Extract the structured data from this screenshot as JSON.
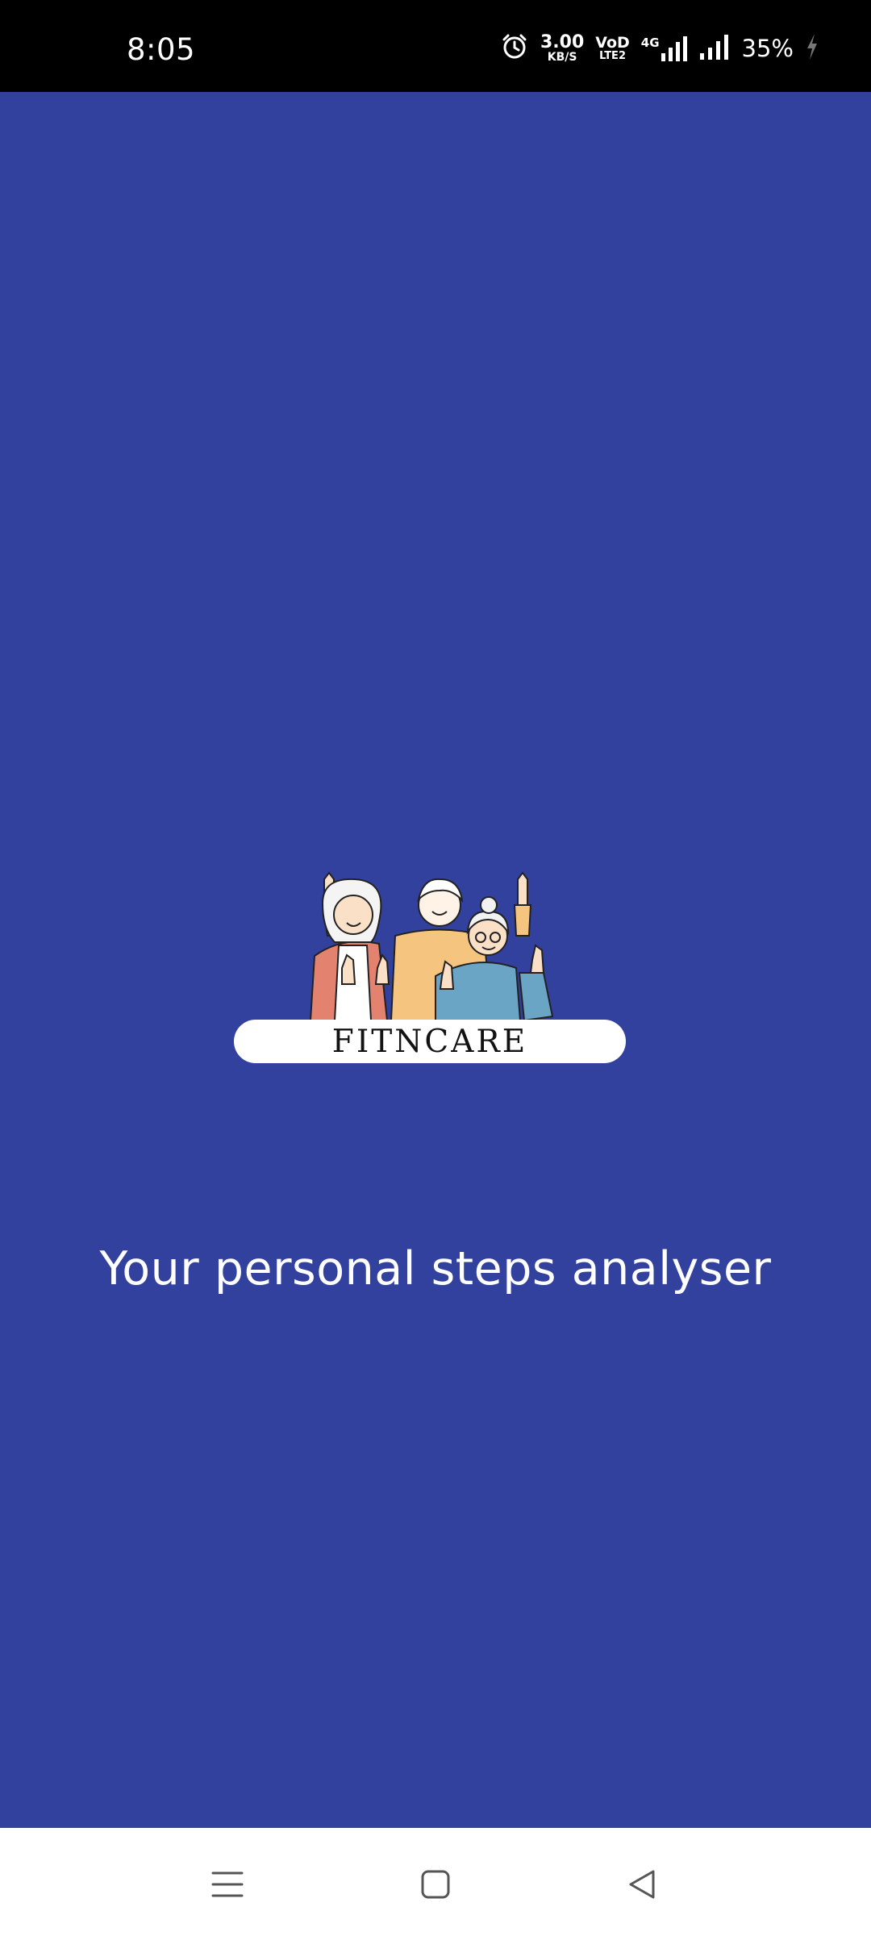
{
  "status_bar": {
    "time": "8:05",
    "net_speed_value": "3.00",
    "net_speed_unit": "KB/S",
    "volte_top": "VoD",
    "volte_bottom": "LTE2",
    "network_type": "4G",
    "battery": "35%",
    "icons": [
      "alarm-icon",
      "volte-icon",
      "signal-4g-icon",
      "signal-icon",
      "battery-charging-icon"
    ]
  },
  "app": {
    "logo_text": "FITNCARE",
    "tagline": "Your personal steps analyser",
    "background_color": "#32409e"
  },
  "nav_bar": {
    "icons": [
      "menu-icon",
      "home-icon",
      "back-icon"
    ]
  }
}
